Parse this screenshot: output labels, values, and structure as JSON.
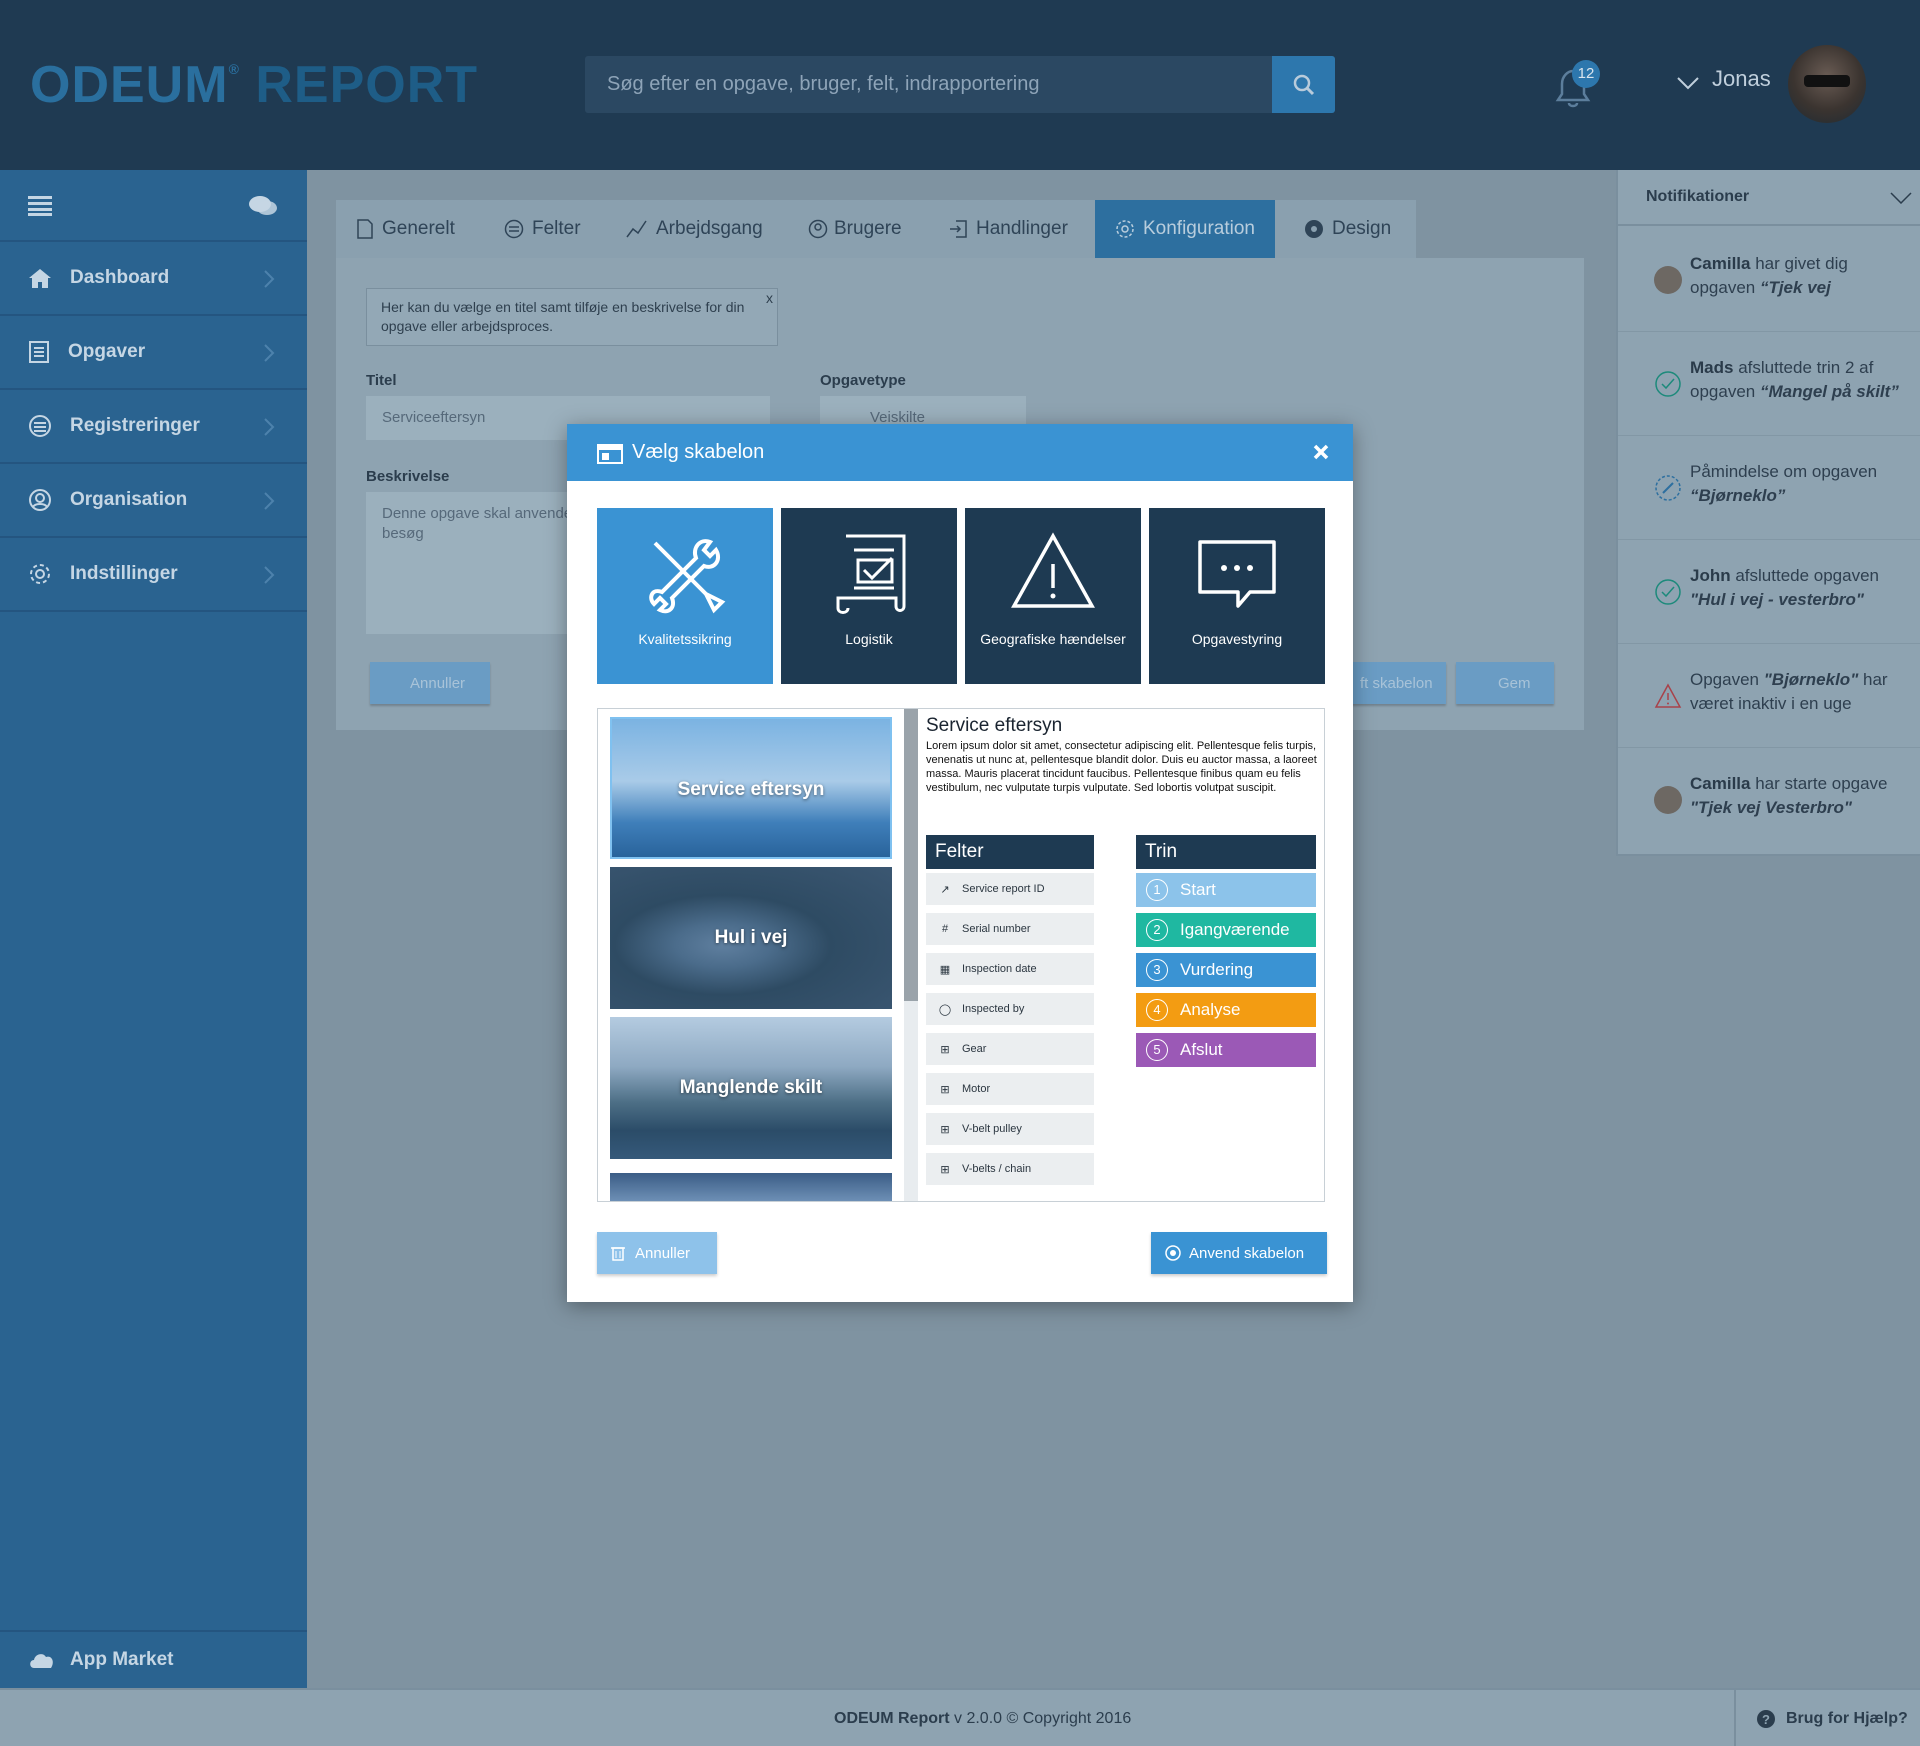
{
  "header": {
    "logo_part1": "ODEUM",
    "logo_part2": "REPORT",
    "logo_reg": "®",
    "search_placeholder": "Søg efter en opgave, bruger, felt, indrapportering",
    "notification_count": "12",
    "user_name": "Jonas"
  },
  "sidebar": {
    "items": [
      {
        "label": "Dashboard",
        "icon": "home-icon"
      },
      {
        "label": "Opgaver",
        "icon": "tasks-icon"
      },
      {
        "label": "Registreringer",
        "icon": "list-icon"
      },
      {
        "label": "Organisation",
        "icon": "user-circle-icon"
      },
      {
        "label": "Indstillinger",
        "icon": "gear-icon"
      }
    ],
    "app_market": "App Market"
  },
  "tabs": [
    {
      "label": "Generelt"
    },
    {
      "label": "Felter"
    },
    {
      "label": "Arbejdsgang"
    },
    {
      "label": "Brugere"
    },
    {
      "label": "Handlinger"
    },
    {
      "label": "Konfiguration"
    },
    {
      "label": "Design"
    }
  ],
  "form": {
    "info": "Her kan du vælge en  titel samt tilføje en beskrivelse for din opgave eller arbejdsproces.",
    "info_close": "x",
    "title_label": "Titel",
    "title_value": "Serviceeftersyn",
    "type_label": "Opgavetype",
    "type_value": "Veiskilte",
    "desc_label": "Beskrivelse",
    "desc_value": "Denne opgave skal anvende serviceeftersyn, når vi besøg",
    "cancel": "Annuller",
    "template_btn_partial": "ft skabelon",
    "save": "Gem"
  },
  "notifications": {
    "title": "Notifikationer",
    "items": [
      {
        "name": "Camilla",
        "text": " har givet dig opgaven ",
        "task": "“Tjek vej",
        "icon": "avatar-icon"
      },
      {
        "name": "Mads",
        "text": " afsluttede trin 2 af opgaven ",
        "task": "“Mangel på skilt”",
        "icon": "check-circle-icon"
      },
      {
        "name": "",
        "text": "Påmindelse om opgaven ",
        "task": "“Bjørneklo”",
        "icon": "edit-icon"
      },
      {
        "name": "John",
        "text": " afsluttede opgaven ",
        "task": "\"Hul i vej - vesterbro\"",
        "icon": "check-circle-icon"
      },
      {
        "name": "",
        "text": "Opgaven ",
        "task": "\"Bjørneklo\"",
        "text2": " har været inaktiv i en uge",
        "icon": "warning-icon"
      },
      {
        "name": "Camilla",
        "text": " har starte opgave ",
        "task": "\"Tjek vej Vesterbro\"",
        "icon": "avatar-icon"
      }
    ]
  },
  "footer": {
    "brand": "ODEUM Report",
    "version": " v 2.0.0 © Copyright 2016",
    "help": "Brug for Hjælp?"
  },
  "modal": {
    "title": "Vælg skabelon",
    "categories": [
      {
        "label": "Kvalitetssikring",
        "icon": "tools-icon"
      },
      {
        "label": "Logistik",
        "icon": "document-check-icon"
      },
      {
        "label": "Geografiske hændelser",
        "icon": "warning-icon"
      },
      {
        "label": "Opgavestyring",
        "icon": "chat-bubble-icon"
      }
    ],
    "templates": [
      {
        "label": "Service eftersyn"
      },
      {
        "label": "Hul i vej"
      },
      {
        "label": "Manglende skilt"
      }
    ],
    "detail": {
      "title": "Service eftersyn",
      "description": "Lorem ipsum dolor sit amet, consectetur adipiscing elit. Pellentesque felis turpis, venenatis ut nunc at, pellentesque blandit dolor. Duis eu auctor massa, a laoreet massa. Mauris placerat tincidunt faucibus. Pellentesque finibus quam eu felis vestibulum, nec vulputate turpis vulputate. Sed lobortis volutpat suscipit.",
      "fields_title": "Felter",
      "fields": [
        {
          "label": "Service report ID",
          "icon": "external-link-icon"
        },
        {
          "label": "Serial number",
          "icon": "hash-icon"
        },
        {
          "label": "Inspection date",
          "icon": "calendar-icon"
        },
        {
          "label": "Inspected by",
          "icon": "user-icon"
        },
        {
          "label": "Gear",
          "icon": "grid-icon"
        },
        {
          "label": "Motor",
          "icon": "grid-icon"
        },
        {
          "label": "V-belt pulley",
          "icon": "grid-icon"
        },
        {
          "label": "V-belts / chain",
          "icon": "grid-icon"
        }
      ],
      "steps_title": "Trin",
      "steps": [
        {
          "num": "1",
          "label": "Start",
          "color": "#8cc3ea"
        },
        {
          "num": "2",
          "label": "Igangværende",
          "color": "#1fb8a1"
        },
        {
          "num": "3",
          "label": "Vurdering",
          "color": "#3a93d3"
        },
        {
          "num": "4",
          "label": "Analyse",
          "color": "#f39c12"
        },
        {
          "num": "5",
          "label": "Afslut",
          "color": "#9b59b6"
        }
      ]
    },
    "cancel": "Annuller",
    "apply": "Anvend skabelon"
  },
  "colors": {
    "accent": "#3a93d3",
    "header": "#1f3a52",
    "sidebar": "#2a6390"
  }
}
